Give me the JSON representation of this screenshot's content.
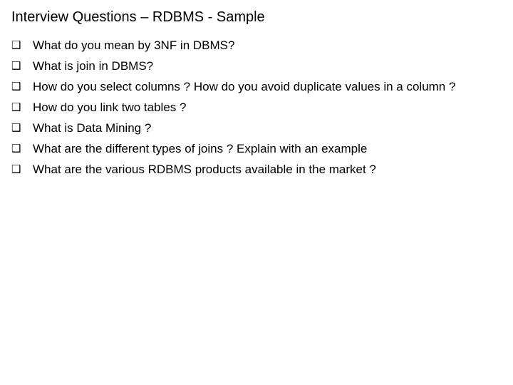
{
  "slide": {
    "title": "Interview Questions – RDBMS - Sample",
    "background_color": "#ffffff",
    "text_color": "#000000",
    "bullet_glyph": "❑",
    "bullet_icon_name": "hollow-square-bullet-icon",
    "items": [
      {
        "text": "What do you mean by 3NF in DBMS?"
      },
      {
        "text": "What is join in DBMS?"
      },
      {
        "text": "How do you select columns ? How do you avoid duplicate values in a column ?"
      },
      {
        "text": "How do you link two tables ?"
      },
      {
        "text": "What is Data Mining ?"
      },
      {
        "text": "What are the different types of joins ? Explain with an example"
      },
      {
        "text": "What are the various RDBMS products available in the market ?"
      }
    ]
  }
}
